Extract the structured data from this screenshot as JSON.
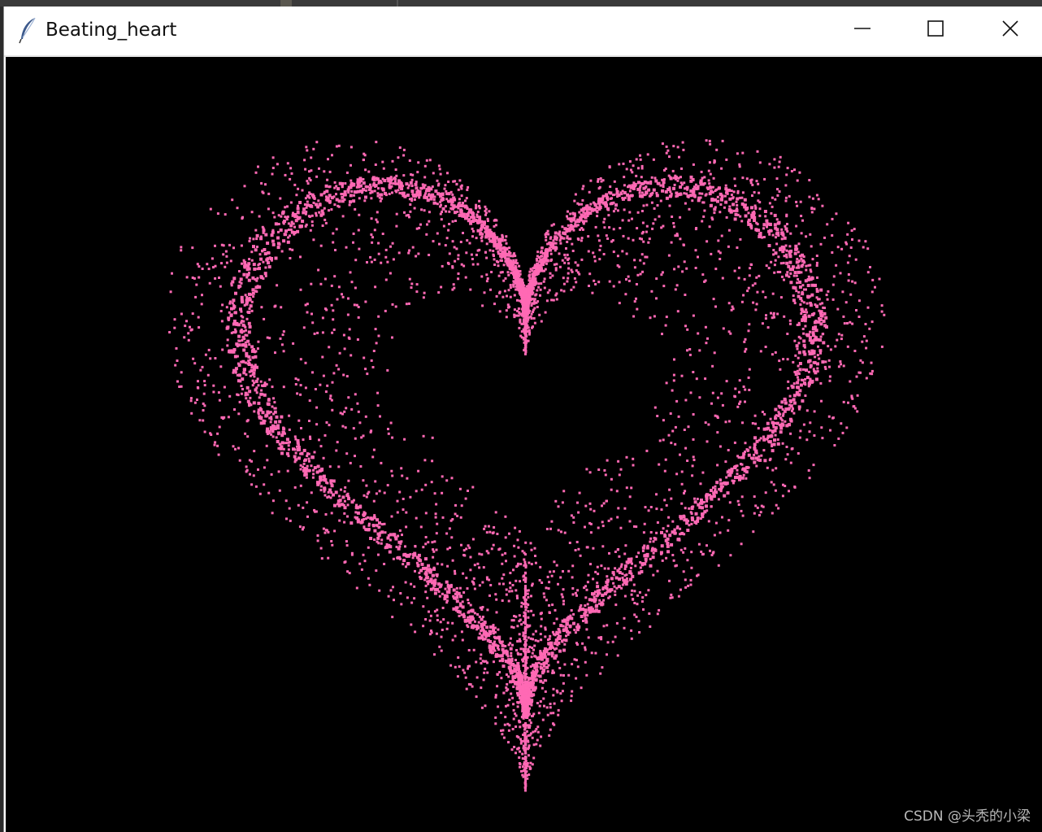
{
  "window": {
    "title": "Beating_heart",
    "icon": "feather-icon",
    "controls": {
      "minimize": "minimize-icon",
      "maximize": "maximize-icon",
      "close": "close-icon"
    }
  },
  "canvas": {
    "background_color": "#000000",
    "particle_color": "#ff69b4",
    "shape": "heart"
  },
  "watermark": "CSDN @头秃的小梁"
}
